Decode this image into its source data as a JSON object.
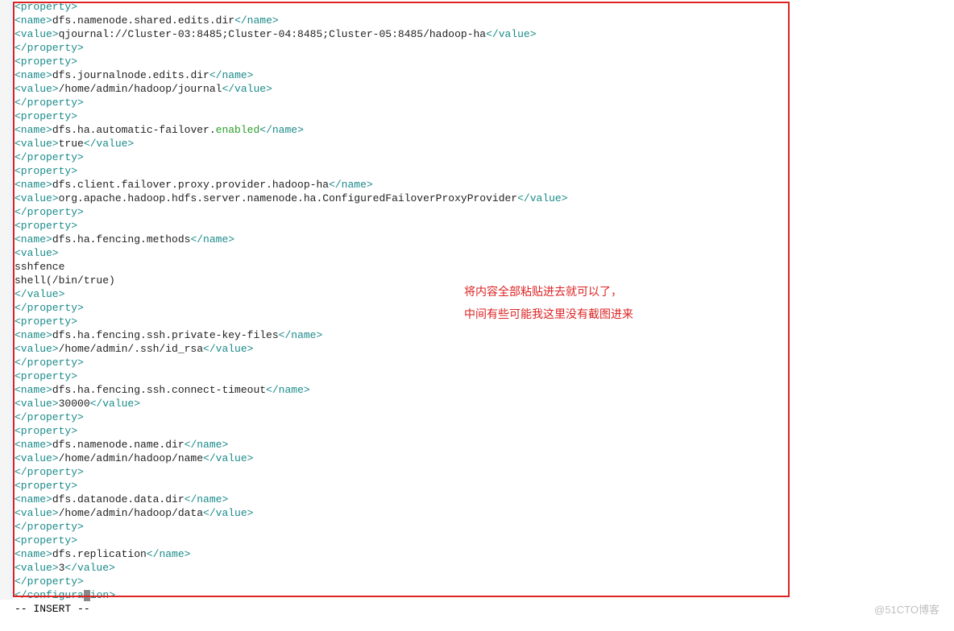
{
  "lines": [
    [
      {
        "c": "tag",
        "t": "<property>"
      }
    ],
    [
      {
        "c": "tag",
        "t": "<name>"
      },
      {
        "c": "txt",
        "t": "dfs.namenode.shared.edits.dir"
      },
      {
        "c": "tag",
        "t": "</name>"
      }
    ],
    [
      {
        "c": "tag",
        "t": "<value>"
      },
      {
        "c": "txt",
        "t": "qjournal://Cluster-03:8485;Cluster-04:8485;Cluster-05:8485/hadoop-ha"
      },
      {
        "c": "tag",
        "t": "</value>"
      }
    ],
    [
      {
        "c": "tag",
        "t": "</property>"
      }
    ],
    [
      {
        "c": "tag",
        "t": "<property>"
      }
    ],
    [
      {
        "c": "tag",
        "t": "<name>"
      },
      {
        "c": "txt",
        "t": "dfs.journalnode.edits.dir"
      },
      {
        "c": "tag",
        "t": "</name>"
      }
    ],
    [
      {
        "c": "tag",
        "t": "<value>"
      },
      {
        "c": "txt",
        "t": "/home/admin/hadoop/journal"
      },
      {
        "c": "tag",
        "t": "</value>"
      }
    ],
    [
      {
        "c": "tag",
        "t": "</property>"
      }
    ],
    [
      {
        "c": "tag",
        "t": "<property>"
      }
    ],
    [
      {
        "c": "tag",
        "t": "<name>"
      },
      {
        "c": "txt",
        "t": "dfs.ha.automatic-failover."
      },
      {
        "c": "kw",
        "t": "enabled"
      },
      {
        "c": "tag",
        "t": "</name>"
      }
    ],
    [
      {
        "c": "tag",
        "t": "<value>"
      },
      {
        "c": "txt",
        "t": "true"
      },
      {
        "c": "tag",
        "t": "</value>"
      }
    ],
    [
      {
        "c": "tag",
        "t": "</property>"
      }
    ],
    [
      {
        "c": "tag",
        "t": "<property>"
      }
    ],
    [
      {
        "c": "tag",
        "t": "<name>"
      },
      {
        "c": "txt",
        "t": "dfs.client.failover.proxy.provider.hadoop-ha"
      },
      {
        "c": "tag",
        "t": "</name>"
      }
    ],
    [
      {
        "c": "tag",
        "t": "<value>"
      },
      {
        "c": "txt",
        "t": "org.apache.hadoop.hdfs.server.namenode.ha.ConfiguredFailoverProxyProvider"
      },
      {
        "c": "tag",
        "t": "</value>"
      }
    ],
    [
      {
        "c": "tag",
        "t": "</property>"
      }
    ],
    [
      {
        "c": "tag",
        "t": "<property>"
      }
    ],
    [
      {
        "c": "tag",
        "t": "<name>"
      },
      {
        "c": "txt",
        "t": "dfs.ha.fencing.methods"
      },
      {
        "c": "tag",
        "t": "</name>"
      }
    ],
    [
      {
        "c": "tag",
        "t": "<value>"
      }
    ],
    [
      {
        "c": "txt",
        "t": "sshfence"
      }
    ],
    [
      {
        "c": "txt",
        "t": "shell(/bin/true)"
      }
    ],
    [
      {
        "c": "tag",
        "t": "</value>"
      }
    ],
    [
      {
        "c": "tag",
        "t": "</property>"
      }
    ],
    [
      {
        "c": "tag",
        "t": "<property>"
      }
    ],
    [
      {
        "c": "tag",
        "t": "<name>"
      },
      {
        "c": "txt",
        "t": "dfs.ha.fencing.ssh.private-key-files"
      },
      {
        "c": "tag",
        "t": "</name>"
      }
    ],
    [
      {
        "c": "tag",
        "t": "<value>"
      },
      {
        "c": "txt",
        "t": "/home/admin/.ssh/id_rsa"
      },
      {
        "c": "tag",
        "t": "</value>"
      }
    ],
    [
      {
        "c": "tag",
        "t": "</property>"
      }
    ],
    [
      {
        "c": "tag",
        "t": "<property>"
      }
    ],
    [
      {
        "c": "tag",
        "t": "<name>"
      },
      {
        "c": "txt",
        "t": "dfs.ha.fencing.ssh.connect-timeout"
      },
      {
        "c": "tag",
        "t": "</name>"
      }
    ],
    [
      {
        "c": "tag",
        "t": "<value>"
      },
      {
        "c": "txt",
        "t": "30000"
      },
      {
        "c": "tag",
        "t": "</value>"
      }
    ],
    [
      {
        "c": "tag",
        "t": "</property>"
      }
    ],
    [
      {
        "c": "tag",
        "t": "<property>"
      }
    ],
    [
      {
        "c": "tag",
        "t": "<name>"
      },
      {
        "c": "txt",
        "t": "dfs.namenode.name.dir"
      },
      {
        "c": "tag",
        "t": "</name>"
      }
    ],
    [
      {
        "c": "tag",
        "t": "<value>"
      },
      {
        "c": "txt",
        "t": "/home/admin/hadoop/name"
      },
      {
        "c": "tag",
        "t": "</value>"
      }
    ],
    [
      {
        "c": "tag",
        "t": "</property>"
      }
    ],
    [
      {
        "c": "tag",
        "t": "<property>"
      }
    ],
    [
      {
        "c": "tag",
        "t": "<name>"
      },
      {
        "c": "txt",
        "t": "dfs.datanode.data.dir"
      },
      {
        "c": "tag",
        "t": "</name>"
      }
    ],
    [
      {
        "c": "tag",
        "t": "<value>"
      },
      {
        "c": "txt",
        "t": "/home/admin/hadoop/data"
      },
      {
        "c": "tag",
        "t": "</value>"
      }
    ],
    [
      {
        "c": "tag",
        "t": "</property>"
      }
    ],
    [
      {
        "c": "tag",
        "t": "<property>"
      }
    ],
    [
      {
        "c": "tag",
        "t": "<name>"
      },
      {
        "c": "txt",
        "t": "dfs.replication"
      },
      {
        "c": "tag",
        "t": "</name>"
      }
    ],
    [
      {
        "c": "tag",
        "t": "<value>"
      },
      {
        "c": "txt",
        "t": "3"
      },
      {
        "c": "tag",
        "t": "</value>"
      }
    ],
    [
      {
        "c": "tag",
        "t": "</property>"
      }
    ]
  ],
  "closing_line": [
    {
      "c": "tag",
      "t": "</configura"
    },
    {
      "c": "cursor",
      "t": ""
    },
    {
      "c": "tag",
      "t": "ion>"
    }
  ],
  "mode_line": "-- INSERT --",
  "annotation": [
    "将内容全部粘贴进去就可以了，",
    "中间有些可能我这里没有截图进来"
  ],
  "watermark": "@51CTO博客"
}
